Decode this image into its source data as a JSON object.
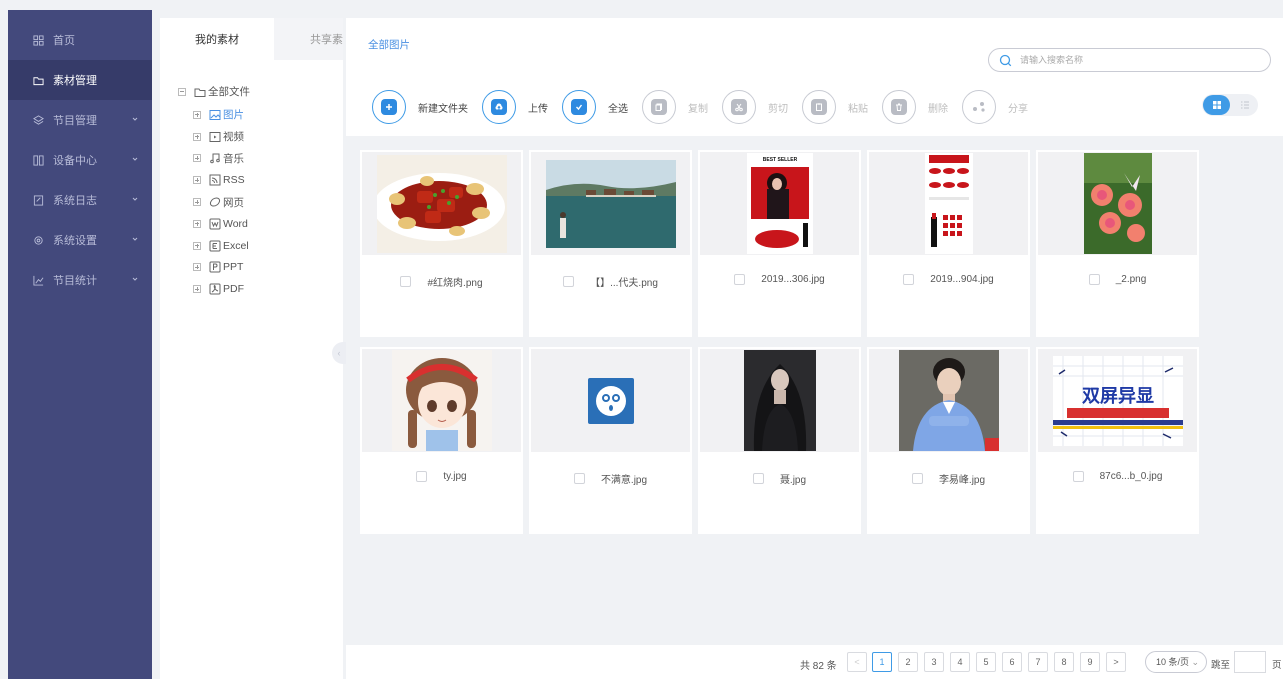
{
  "sidebar": {
    "items": [
      {
        "label": "首页",
        "icon": "dashboard-icon",
        "expandable": false,
        "active": false
      },
      {
        "label": "素材管理",
        "icon": "folder-icon",
        "expandable": false,
        "active": true
      },
      {
        "label": "节目管理",
        "icon": "layers-icon",
        "expandable": true,
        "active": false
      },
      {
        "label": "设备中心",
        "icon": "device-icon",
        "expandable": true,
        "active": false
      },
      {
        "label": "系统日志",
        "icon": "log-icon",
        "expandable": true,
        "active": false
      },
      {
        "label": "系统设置",
        "icon": "settings-icon",
        "expandable": true,
        "active": false
      },
      {
        "label": "节目统计",
        "icon": "chart-icon",
        "expandable": true,
        "active": false
      }
    ]
  },
  "tree": {
    "tabs": [
      "我的素材",
      "共享素材"
    ],
    "root": "全部文件",
    "items": [
      {
        "label": "图片",
        "icon": "image-icon",
        "selected": true
      },
      {
        "label": "视频",
        "icon": "video-icon",
        "selected": false
      },
      {
        "label": "音乐",
        "icon": "music-icon",
        "selected": false
      },
      {
        "label": "RSS",
        "icon": "rss-icon",
        "selected": false
      },
      {
        "label": "网页",
        "icon": "web-icon",
        "selected": false
      },
      {
        "label": "Word",
        "icon": "word-icon",
        "selected": false
      },
      {
        "label": "Excel",
        "icon": "excel-icon",
        "selected": false
      },
      {
        "label": "PPT",
        "icon": "ppt-icon",
        "selected": false
      },
      {
        "label": "PDF",
        "icon": "pdf-icon",
        "selected": false
      }
    ]
  },
  "breadcrumb": "全部图片",
  "search": {
    "placeholder": "请输入搜索名称"
  },
  "toolbar": [
    {
      "label": "新建文件夹",
      "icon": "new-folder-icon",
      "enabled": true
    },
    {
      "label": "上传",
      "icon": "upload-icon",
      "enabled": true
    },
    {
      "label": "全选",
      "icon": "select-all-icon",
      "enabled": true
    },
    {
      "label": "复制",
      "icon": "copy-icon",
      "enabled": false
    },
    {
      "label": "剪切",
      "icon": "cut-icon",
      "enabled": false
    },
    {
      "label": "粘贴",
      "icon": "paste-icon",
      "enabled": false
    },
    {
      "label": "删除",
      "icon": "delete-icon",
      "enabled": false
    },
    {
      "label": "分享",
      "icon": "share-icon",
      "enabled": false
    }
  ],
  "view_mode": "grid",
  "files": [
    {
      "name": "#红烧肉.png",
      "thumb": "food"
    },
    {
      "name": "【】...代夫.png",
      "thumb": "lake"
    },
    {
      "name": "2019...306.jpg",
      "thumb": "lipstick-poster"
    },
    {
      "name": "2019...904.jpg",
      "thumb": "lipstick-catalog"
    },
    {
      "name": "_2.png",
      "thumb": "flowers"
    },
    {
      "name": "ty.jpg",
      "thumb": "anime-girl"
    },
    {
      "name": "不满意.jpg",
      "thumb": "sad-face"
    },
    {
      "name": "聂.jpg",
      "thumb": "dark-portrait"
    },
    {
      "name": "李易峰.jpg",
      "thumb": "man-portrait"
    },
    {
      "name": "87c6...b_0.jpg",
      "thumb": "dual-screen"
    }
  ],
  "dual_screen_title": "双屏异显",
  "pagination": {
    "total": "共 82 条",
    "pages": [
      "1",
      "2",
      "3",
      "4",
      "5",
      "6",
      "7",
      "8",
      "9"
    ],
    "current": "1",
    "prev": "<",
    "next": ">",
    "page_size": "10 条/页",
    "goto": "跳至",
    "page_suffix": "页"
  },
  "colors": {
    "sidebar_bg": "#43497c",
    "sidebar_active": "#363b69",
    "accent": "#3f9be6",
    "disabled": "#b9bcc4"
  }
}
